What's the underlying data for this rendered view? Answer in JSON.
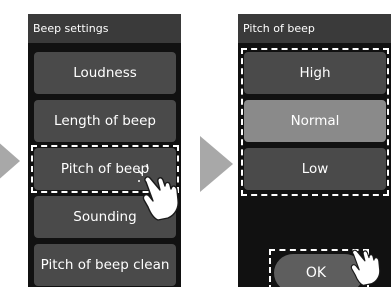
{
  "screen_left": {
    "title": "Beep settings",
    "items": [
      {
        "label": "Loudness"
      },
      {
        "label": "Length of beep"
      },
      {
        "label": "Pitch of beep"
      },
      {
        "label": "Sounding"
      },
      {
        "label": "Pitch of beep clean"
      }
    ]
  },
  "screen_right": {
    "title": "Pitch of beep",
    "options": [
      {
        "label": "High"
      },
      {
        "label": "Normal"
      },
      {
        "label": "Low"
      }
    ],
    "selected": "Normal",
    "ok_label": "OK"
  },
  "icons": [
    "arrow-right-icon",
    "tapping-hand-icon"
  ],
  "colors": {
    "screen_bg": "#111111",
    "title_bar": "#3a3a3a",
    "button": "#4a4a4a",
    "selected_button": "#8a8a8a",
    "arrow": "#a8a8a8"
  }
}
